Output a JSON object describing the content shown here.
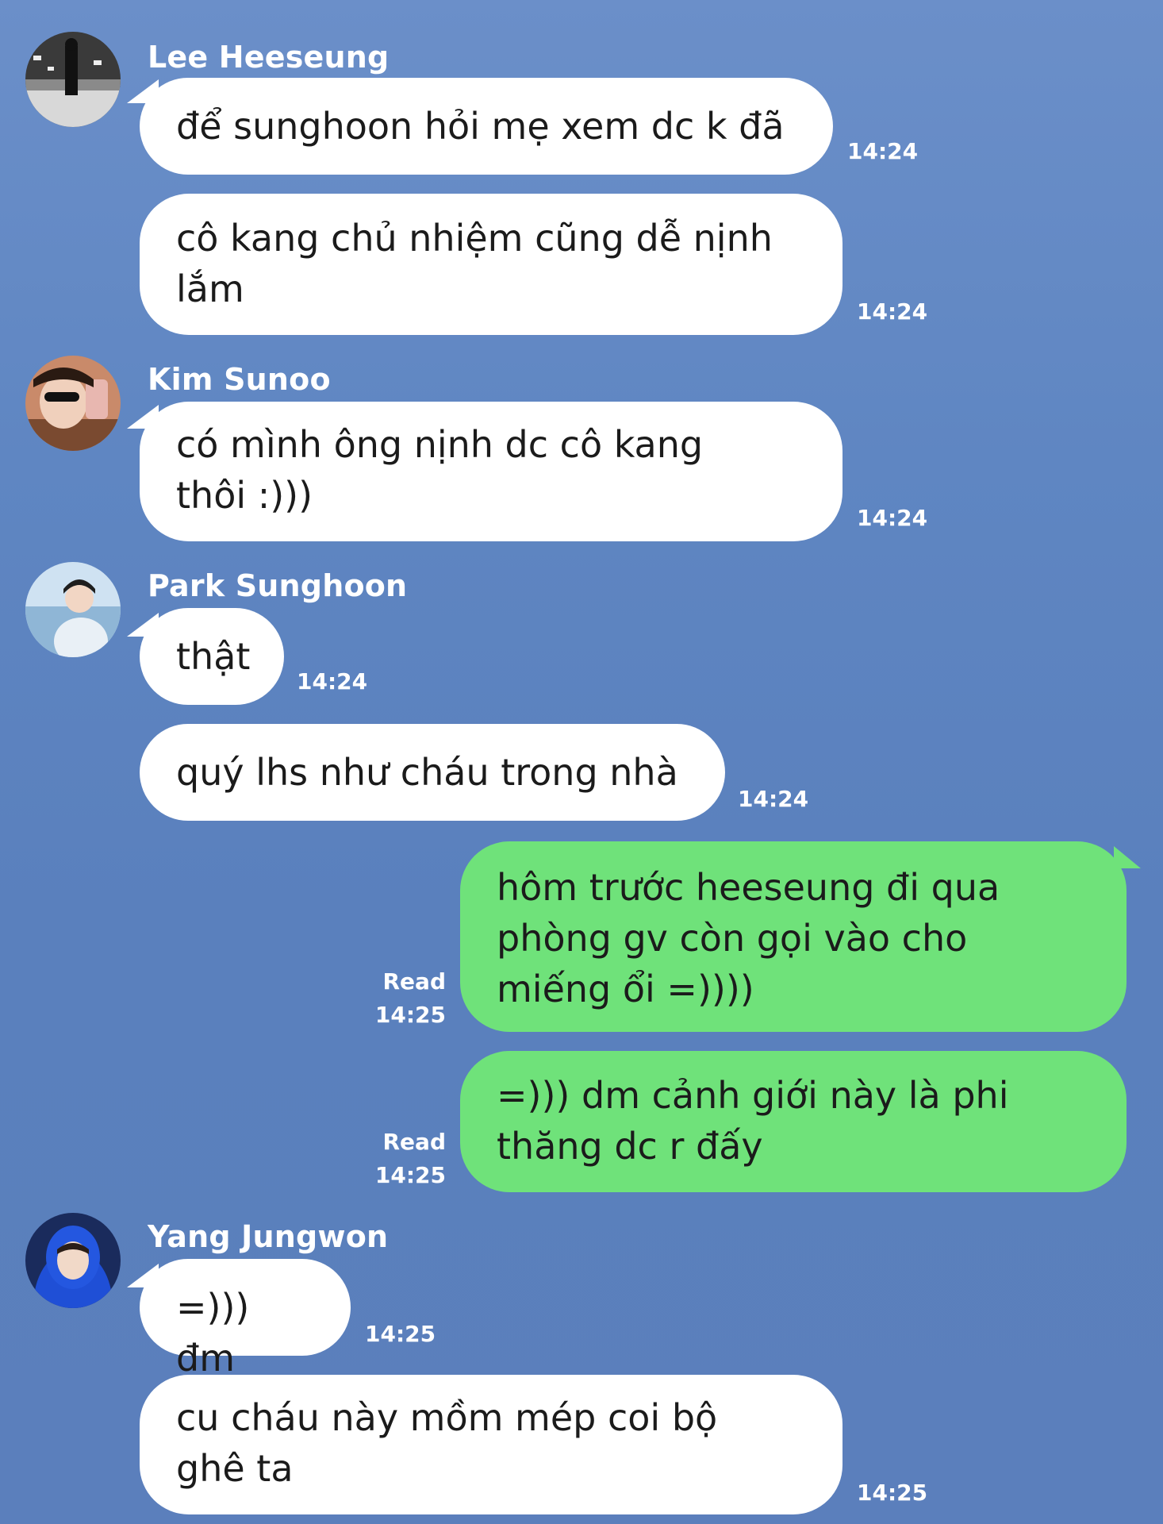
{
  "chat": {
    "groups": [
      {
        "sender": "Lee Heeseung",
        "avatar": "person-walking-avatar",
        "messages": [
          {
            "text": "để sunghoon hỏi mẹ xem dc k đã",
            "time": "14:24"
          },
          {
            "text": "cô kang chủ nhiệm cũng dễ nịnh\nlắm",
            "time": "14:24"
          }
        ]
      },
      {
        "sender": "Kim Sunoo",
        "avatar": "selfie-avatar",
        "messages": [
          {
            "text": "có mình ông nịnh dc cô kang\nthôi :)))",
            "time": "14:24"
          }
        ]
      },
      {
        "sender": "Park Sunghoon",
        "avatar": "seaside-avatar",
        "messages": [
          {
            "text": "thật",
            "time": "14:24"
          },
          {
            "text": "quý lhs như cháu trong nhà",
            "time": "14:24"
          }
        ]
      },
      {
        "sender": "me",
        "messages": [
          {
            "text": "hôm trước heeseung đi qua\nphòng gv còn gọi vào cho\nmiếng ổi =))))",
            "status": "Read",
            "time": "14:25"
          },
          {
            "text": "=))) dm cảnh giới này là phi\nthăng dc r đấy",
            "status": "Read",
            "time": "14:25"
          }
        ]
      },
      {
        "sender": "Yang Jungwon",
        "avatar": "blue-hoodie-avatar",
        "messages": [
          {
            "text": "=))) đm",
            "time": "14:25"
          },
          {
            "text": "cu cháu này mồm mép coi bộ\nghê ta",
            "time": "14:25"
          }
        ]
      }
    ]
  },
  "colors": {
    "background": "#5f86c2",
    "incoming_bubble": "#ffffff",
    "outgoing_bubble": "#6fe27a",
    "meta_text": "#ffffff"
  }
}
